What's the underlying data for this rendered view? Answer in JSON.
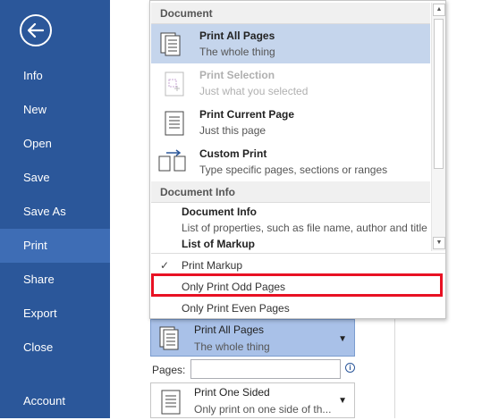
{
  "sidebar": {
    "items": [
      {
        "label": "Info"
      },
      {
        "label": "New"
      },
      {
        "label": "Open"
      },
      {
        "label": "Save"
      },
      {
        "label": "Save As"
      },
      {
        "label": "Print",
        "active": true
      },
      {
        "label": "Share"
      },
      {
        "label": "Export"
      },
      {
        "label": "Close"
      },
      {
        "label": "Account"
      }
    ],
    "back_icon": "back-arrow-icon",
    "background_color": "#2b579a",
    "active_color": "#3e6db5"
  },
  "dropdown": {
    "sections": {
      "document": "Document",
      "document_info": "Document Info"
    },
    "items": [
      {
        "title": "Print All Pages",
        "subtitle": "The whole thing",
        "icon": "all-pages-icon",
        "state": "selected"
      },
      {
        "title": "Print Selection",
        "subtitle": "Just what you selected",
        "icon": "selection-icon",
        "state": "disabled"
      },
      {
        "title": "Print Current Page",
        "subtitle": "Just this page",
        "icon": "current-page-icon",
        "state": "normal"
      },
      {
        "title": "Custom Print",
        "subtitle": "Type specific pages, sections or ranges",
        "icon": "custom-print-icon",
        "state": "normal"
      }
    ],
    "info_items": [
      {
        "title": "Document Info",
        "subtitle": "List of properties, such as file name, author and title"
      },
      {
        "title": "List of Markup",
        "subtitle": ""
      }
    ],
    "options": [
      {
        "label": "Print Markup",
        "checked": true,
        "check_mark": "✓"
      },
      {
        "label": "Only Print Odd Pages",
        "checked": false,
        "highlighted": true
      },
      {
        "label": "Only Print Even Pages",
        "checked": false
      }
    ],
    "highlight_color": "#e81123"
  },
  "settings": {
    "print_range": {
      "title": "Print All Pages",
      "subtitle": "The whole thing"
    },
    "pages_label": "Pages:",
    "pages_value": "",
    "sided": {
      "title": "Print One Sided",
      "subtitle": "Only print on one side of th..."
    }
  }
}
